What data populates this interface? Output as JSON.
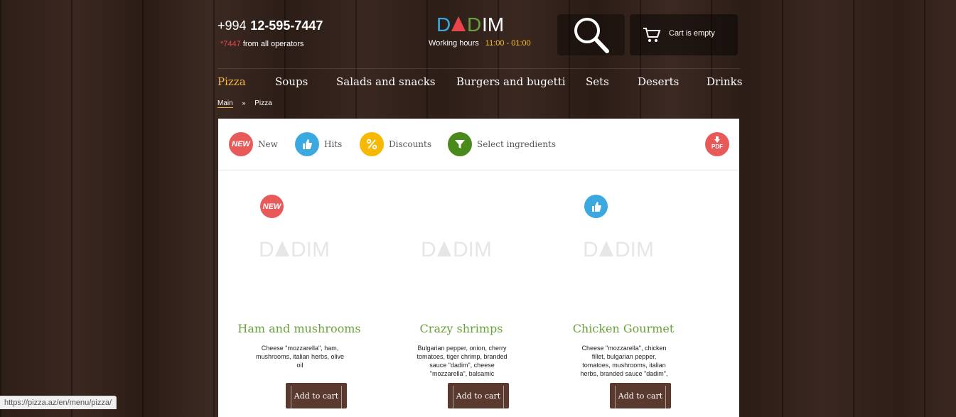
{
  "header": {
    "phone_code": "+994",
    "phone_number": "12-595-7447",
    "operators_star": "*7447",
    "operators_text": "from all operators",
    "logo_text": "DADIM",
    "hours_label": "Working hours",
    "hours_time": "11:00 - 01:00",
    "cart_label": "Cart is empty"
  },
  "nav": {
    "items": [
      {
        "label": "Pizza",
        "active": true
      },
      {
        "label": "Soups"
      },
      {
        "label": "Salads and snacks"
      },
      {
        "label": "Burgers and bugetti"
      },
      {
        "label": "Sets"
      },
      {
        "label": "Deserts"
      },
      {
        "label": "Drinks"
      }
    ]
  },
  "breadcrumb": {
    "main": "Main",
    "separator": "»",
    "current": "Pizza"
  },
  "filters": {
    "items": [
      {
        "label": "New",
        "badge": "NEW",
        "color": "#e85a5a"
      },
      {
        "label": "Hits",
        "icon": "thumbs-up-icon",
        "color": "#3ba9e0"
      },
      {
        "label": "Discounts",
        "icon": "percent-icon",
        "color": "#f6b800"
      },
      {
        "label": "Select ingredients",
        "icon": "filter-icon",
        "color": "#4a8a1c"
      }
    ],
    "pdf_label": "PDF"
  },
  "products": [
    {
      "name": "Ham and mushrooms",
      "description": "Cheese \"mozzarella\", ham, mushrooms, italian herbs, olive oil",
      "badge": "NEW",
      "placeholder": "DADIM",
      "button": "Add to cart"
    },
    {
      "name": "Crazy shrimps",
      "description": "Bulgarian pepper, onion, cherry tomatoes, tiger chrimp, branded sauce \"dadim\", cheese \"mozzarella\", balsamic",
      "badge": "",
      "placeholder": "DADIM",
      "button": "Add to cart"
    },
    {
      "name": "Chicken Gourmet",
      "description": "Cheese \"mozzarella\", chicken fillet, bulgarian pepper, tomatoes, mushrooms, italian herbs, branded sauce \"dadim\",",
      "badge": "hit",
      "placeholder": "DADIM",
      "button": "Add to cart"
    }
  ],
  "status_bar": {
    "url": "https://pizza.az/en/menu/pizza/"
  },
  "colors": {
    "accent_nav": "#f2b94a",
    "hours_time": "#f6c12b",
    "product_name": "#6aa03b",
    "button_bg": "#5a3a2e"
  }
}
